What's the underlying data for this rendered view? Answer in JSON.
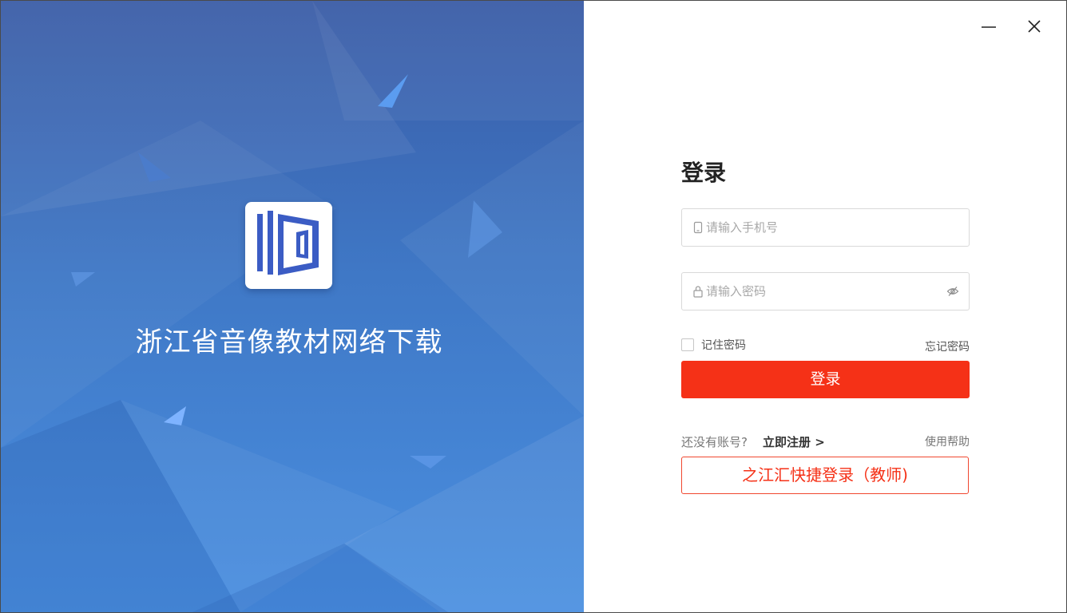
{
  "window": {
    "minimize_icon": "minimize-icon",
    "close_icon": "close-icon"
  },
  "hero": {
    "app_title": "浙江省音像教材网络下载",
    "logo": "app-logo"
  },
  "login": {
    "title": "登录",
    "phone_placeholder": "请输入手机号",
    "password_placeholder": "请输入密码",
    "remember_label": "记住密码",
    "remember_checked": false,
    "forgot_label": "忘记密码",
    "submit_label": "登录",
    "no_account_text": "还没有账号?",
    "register_label": "立即注册 >",
    "help_label": "使用帮助",
    "teacher_login_label": "之江汇快捷登录（教师)"
  },
  "colors": {
    "accent": "#f53117",
    "hero_top": "#3a5ca6",
    "hero_bottom": "#4a8fe0",
    "logo_blue": "#3b5cc4"
  }
}
